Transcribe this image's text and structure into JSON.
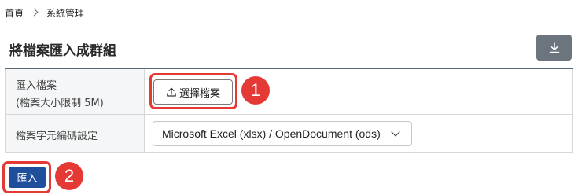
{
  "breadcrumb": {
    "home": "首頁",
    "current": "系統管理"
  },
  "page": {
    "title": "將檔案匯入成群組"
  },
  "form": {
    "file_label_line1": "匯入檔案",
    "file_label_line2": "(檔案大小限制 5M)",
    "choose_file_button": "選擇檔案",
    "encoding_label": "檔案字元編碼設定",
    "encoding_selected": "Microsoft Excel (xlsx) / OpenDocument (ods)"
  },
  "actions": {
    "import_button": "匯入"
  },
  "annotations": {
    "step1": "1",
    "step2": "2",
    "color": "#e53935"
  },
  "colors": {
    "primary": "#1f4e9c",
    "download_bg": "#6c757d"
  },
  "icons": {
    "download": "download-icon",
    "upload": "upload-icon",
    "breadcrumb_sep": "chevron-right-icon",
    "select": "chevron-down-icon"
  }
}
